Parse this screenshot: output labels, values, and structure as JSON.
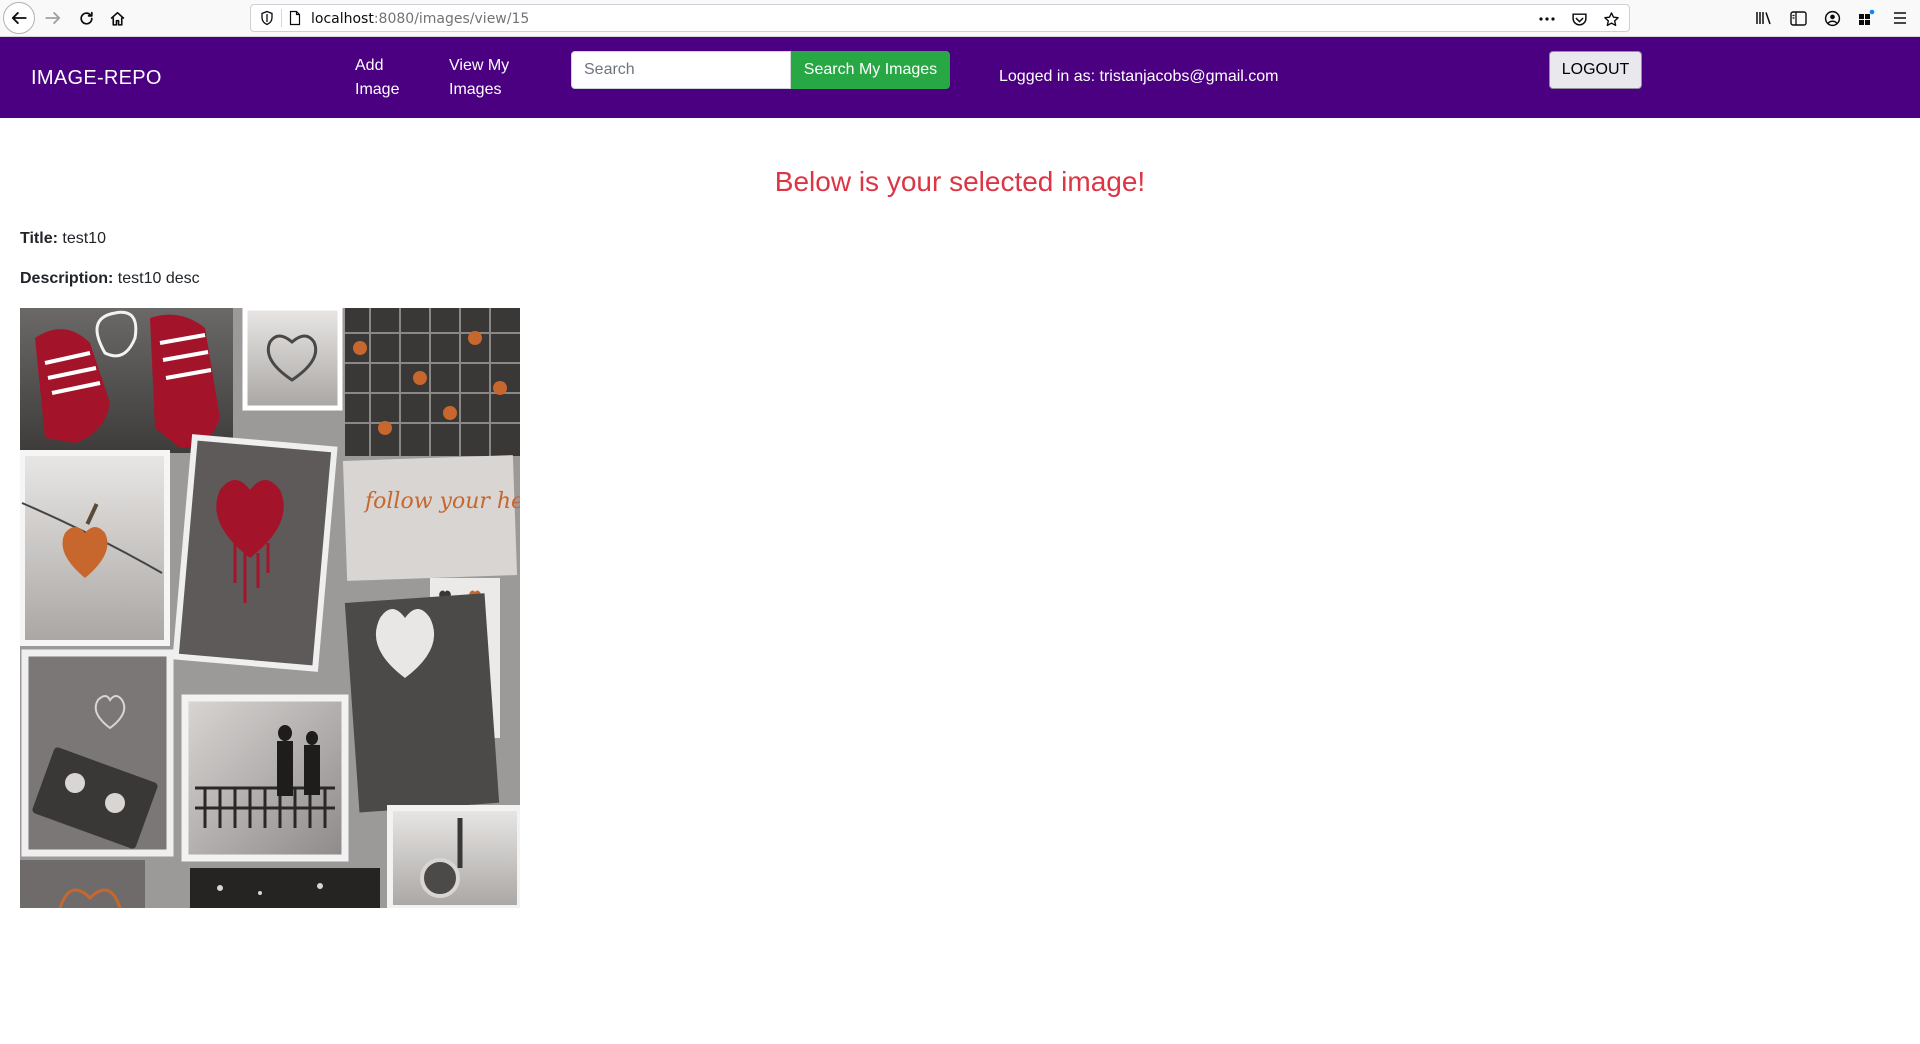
{
  "browser": {
    "url_host": "localhost",
    "url_rest": ":8080/images/view/15"
  },
  "navbar": {
    "brand": "IMAGE-REPO",
    "add_image": "Add Image",
    "view_my_images": "View My Images",
    "search_placeholder": "Search",
    "search_button": "Search My Images",
    "logged_in": "Logged in as: tristanjacobs@gmail.com",
    "logout": "LOGOUT",
    "background_color": "#4b0082",
    "search_button_color": "#28a745"
  },
  "main": {
    "heading": "Below is your selected image!",
    "heading_color": "#dc3545",
    "title_label": "Title:",
    "title_value": "test10",
    "description_label": "Description:",
    "description_value": "test10 desc",
    "image_alt": "collage of hearts, sneakers, locks, cassette and couple photos"
  },
  "collage_text": {
    "note": "follow your heart"
  }
}
